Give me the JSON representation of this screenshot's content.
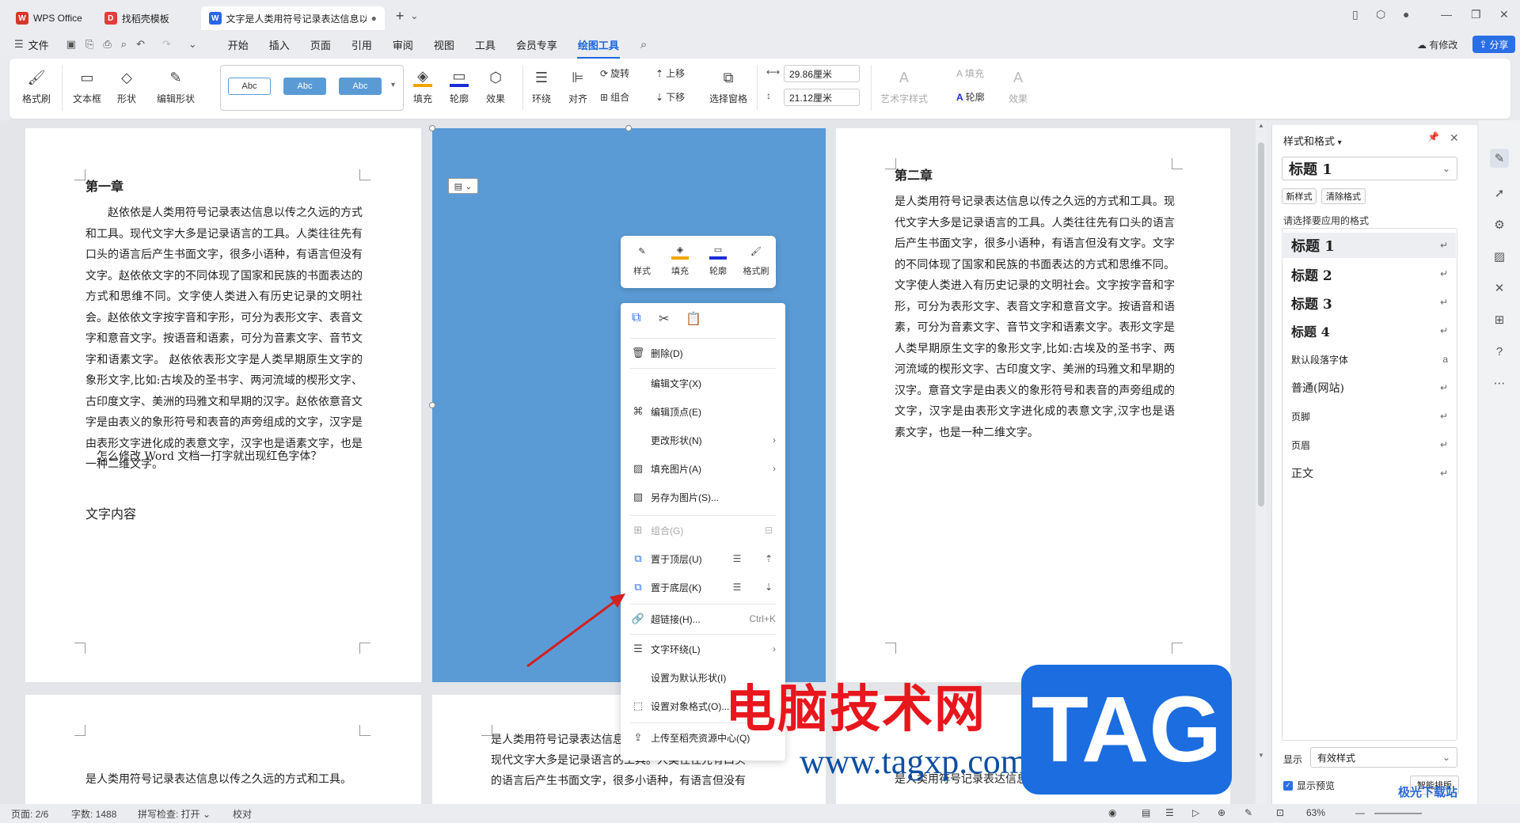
{
  "tabs": [
    {
      "label": "WPS Office",
      "logo": "W",
      "color": "#d7372b"
    },
    {
      "label": "找稻壳模板",
      "logo": "D",
      "color": "#e23b3b"
    },
    {
      "label": "文字是人类用符号记录表达信息以",
      "logo": "W",
      "color": "#2b66e3"
    }
  ],
  "menu": {
    "file_label": "文件",
    "items": [
      "开始",
      "插入",
      "页面",
      "引用",
      "审阅",
      "视图",
      "工具",
      "会员专享",
      "绘图工具"
    ],
    "active": "绘图工具",
    "changes_label": "有修改",
    "share_label": "分享"
  },
  "ribbon": {
    "format_painter": "格式刷",
    "textbox": "文本框",
    "shape": "形状",
    "edit_shape": "编辑形状",
    "abc": [
      "Abc",
      "Abc",
      "Abc"
    ],
    "fill": "填充",
    "outline": "轮廓",
    "effect": "效果",
    "wrap": "环绕",
    "align": "对齐",
    "rotate": "旋转",
    "group": "组合",
    "bring_forward": "上移",
    "send_backward": "下移",
    "selection_pane": "选择窗格",
    "width_value": "29.86厘米",
    "height_value": "21.12厘米",
    "art_style": "艺术字样式",
    "text_fill": "填充",
    "text_outline": "轮廓",
    "text_effect": "效果"
  },
  "page1": {
    "chapter": "第一章",
    "paragraph": "赵依依是人类用符号记录表达信息以传之久远的方式和工具。现代文字大多是记录语言的工具。人类往往先有口头的语言后产生书面文字，很多小语种，有语言但没有文字。赵依依文字的不同体现了国家和民族的书面表达的方式和思维不同。文字使人类进入有历史记录的文明社会。赵依依文字按字音和字形，可分为表形文字、表音文字和意音文字。按语音和语素，可分为音素文字、音节文字和语素文字。 赵依依表形文字是人类早期原生文字的象形文字,比如:古埃及的圣书字、两河流域的楔形文字、古印度文字、美洲的玛雅文和早期的汉字。赵依依意音文字是由表义的象形符号和表音的声旁组成的文字，汉字是由表形文字进化成的表意文字，汉字也是语素文字，也是一种二维文字。",
    "question": "怎么修改 Word 文档一打字就出现红色字体？",
    "section": "文字内容"
  },
  "page3": {
    "chapter": "第二章",
    "paragraph": "是人类用符号记录表达信息以传之久远的方式和工具。现代文字大多是记录语言的工具。人类往往先有口头的语言后产生书面文字，很多小语种，有语言但没有文字。文字的不同体现了国家和民族的书面表达的方式和思维不同。文字使人类进入有历史记录的文明社会。文字按字音和字形，可分为表形文字、表音文字和意音文字。按语音和语素，可分为音素文字、音节文字和语素文字。表形文字是人类早期原生文字的象形文字,比如:古埃及的圣书字、两河流域的楔形文字、古印度文字、美洲的玛雅文和早期的汉字。意音文字是由表义的象形符号和表音的声旁组成的文字，汉字是由表形文字进化成的表意文字,汉字也是语素文字，也是一种二维文字。"
  },
  "page4": {
    "line1": "是人类用符号记录表达信息以传之久远的方式和工具。"
  },
  "page5": {
    "line1": "是人类用符号记录表达信息以传之久远",
    "line2": "现代文字大多是记录语言的工具。人类往往先有口头",
    "line3": "的语言后产生书面文字，很多小语种，有语言但没有"
  },
  "page6": {
    "line1": "是人类用符号记录表达信息以传之久远的方式和工具。"
  },
  "minibar": [
    "样式",
    "填充",
    "轮廓",
    "格式刷"
  ],
  "context_menu": {
    "delete": "删除(D)",
    "edit_text": "编辑文字(X)",
    "edit_points": "编辑顶点(E)",
    "change_shape": "更改形状(N)",
    "fill_picture": "填充图片(A)",
    "save_as_picture": "另存为图片(S)...",
    "group": "组合(G)",
    "bring_to_top": "置于顶层(U)",
    "send_to_bottom": "置于底层(K)",
    "hyperlink": "超链接(H)...",
    "hyperlink_shortcut": "Ctrl+K",
    "text_wrap": "文字环绕(L)",
    "set_default": "设置为默认形状(I)",
    "format_object": "设置对象格式(O)...",
    "upload": "上传至稻壳资源中心(Q)"
  },
  "panel": {
    "title": "样式和格式",
    "current_style": "标题 1",
    "new_style": "新样式",
    "clear_format": "清除格式",
    "apply_label": "请选择要应用的格式",
    "styles": [
      "标题 1",
      "标题 2",
      "标题 3",
      "标题 4",
      "默认段落字体",
      "普通(网站)",
      "页脚",
      "页眉",
      "正文"
    ],
    "show_label": "显示",
    "show_value": "有效样式",
    "preview_label": "显示预览",
    "smart_label": "智能排版"
  },
  "status": {
    "page": "页面: 2/6",
    "words": "字数: 1488",
    "spell": "拼写检查: 打开",
    "proof": "校对",
    "zoom": "63%"
  },
  "watermark": {
    "cn": "电脑技术网",
    "url": "www.tagxp.com",
    "tag": "TAG",
    "xz": "极光下载站"
  }
}
